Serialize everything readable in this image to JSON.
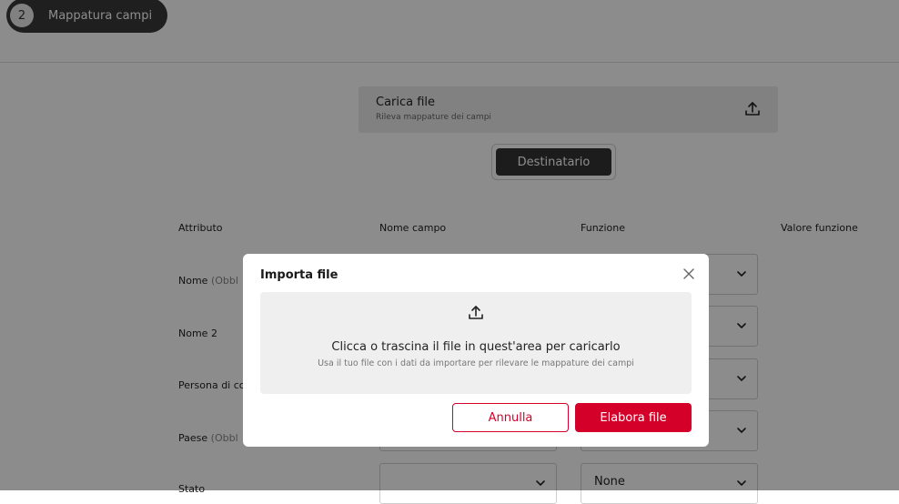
{
  "stepper": {
    "number": "2",
    "label": "Mappatura campi"
  },
  "upload_card": {
    "title": "Carica file",
    "subtitle": "Rileva mappature dei campi",
    "icon": "upload-icon"
  },
  "recipient_button": {
    "label": "Destinatario"
  },
  "columns": {
    "attribute": "Attributo",
    "field_name": "Nome campo",
    "function": "Funzione",
    "function_value": "Valore funzione"
  },
  "rows": [
    {
      "label": "Nome",
      "suffix": "(Obbl"
    },
    {
      "label": "Nome 2",
      "suffix": ""
    },
    {
      "label": "Persona di co",
      "suffix": ""
    },
    {
      "label": "Paese",
      "suffix": "(Obbl"
    },
    {
      "label": "Stato",
      "suffix": ""
    }
  ],
  "function_select": {
    "visible_value": "None"
  },
  "modal": {
    "title": "Importa file",
    "dropzone_text": "Clicca o trascina il file in quest'area per caricarlo",
    "dropzone_subtext": "Usa il tuo file con i dati da importare per rilevare le mappature dei campi",
    "cancel_label": "Annulla",
    "submit_label": "Elabora file"
  },
  "colors": {
    "accent": "#d4002a",
    "dark_button": "#333333",
    "overlay": "rgba(0,0,0,0.45)"
  }
}
